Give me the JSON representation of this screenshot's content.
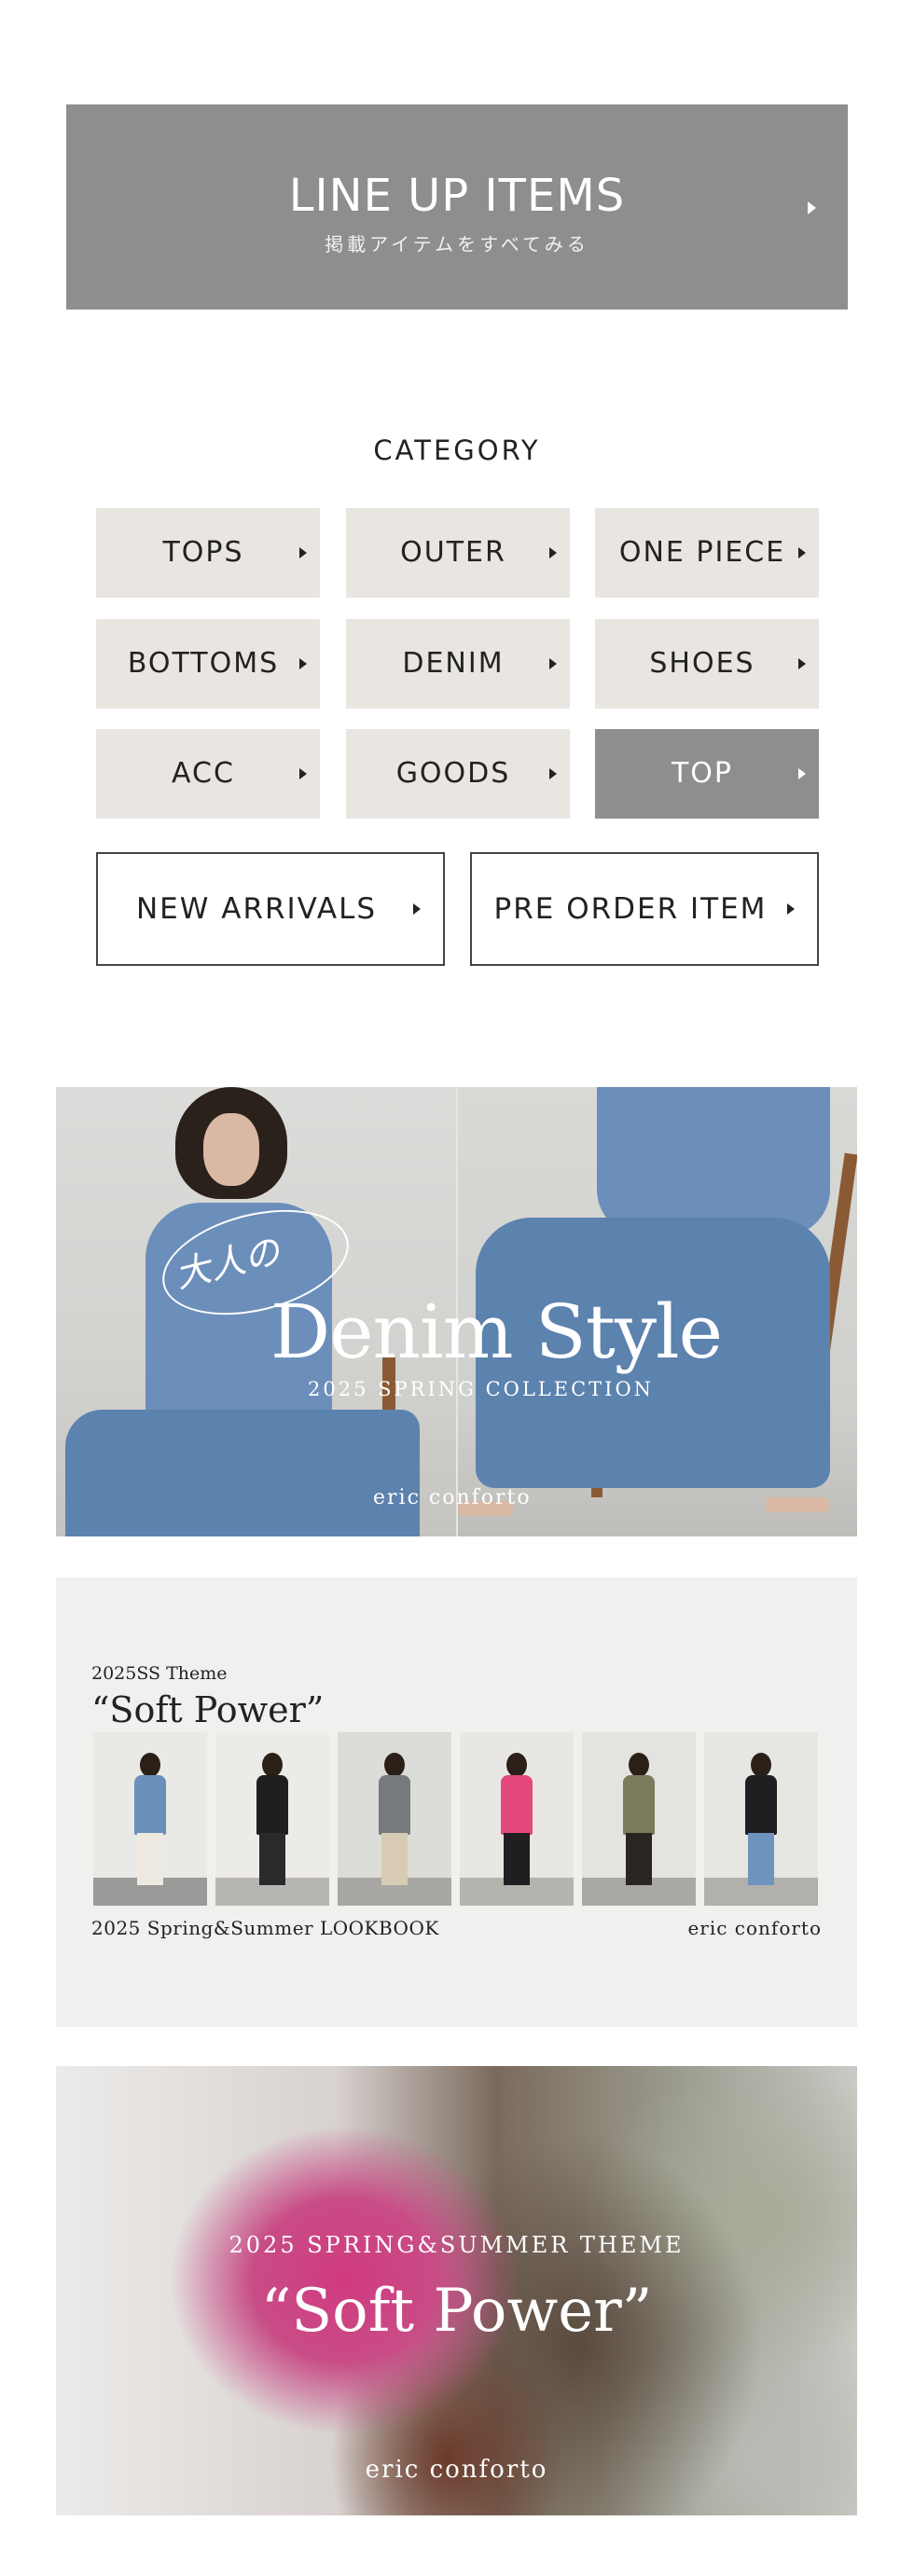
{
  "lineup": {
    "title": "LINE UP ITEMS",
    "subtitle": "掲載アイテムをすべてみる"
  },
  "category": {
    "title": "CATEGORY",
    "items": [
      {
        "label": "TOPS"
      },
      {
        "label": "OUTER"
      },
      {
        "label": "ONE PIECE"
      },
      {
        "label": "BOTTOMS"
      },
      {
        "label": "DENIM"
      },
      {
        "label": "SHOES"
      },
      {
        "label": "ACC"
      },
      {
        "label": "GOODS"
      },
      {
        "label": "TOP"
      }
    ],
    "new_arrivals": "NEW ARRIVALS",
    "pre_order": "PRE ORDER ITEM"
  },
  "banner_denim": {
    "script": "大人の",
    "title": "Denim Style",
    "subtitle": "2025 SPRING COLLECTION",
    "brand": "eric conforto"
  },
  "banner_lookbook": {
    "theme": "2025SS Theme",
    "title": "“Soft Power”",
    "caption": "2025 Spring&Summer LOOKBOOK",
    "brand": "eric conforto"
  },
  "banner_softpower": {
    "subtitle": "2025 SPRING&SUMMER THEME",
    "title": "“Soft Power”",
    "brand": "eric conforto"
  },
  "colors": {
    "gray_button": "#8e8e8e",
    "beige_button": "#e9e5e1",
    "text": "#222222"
  }
}
